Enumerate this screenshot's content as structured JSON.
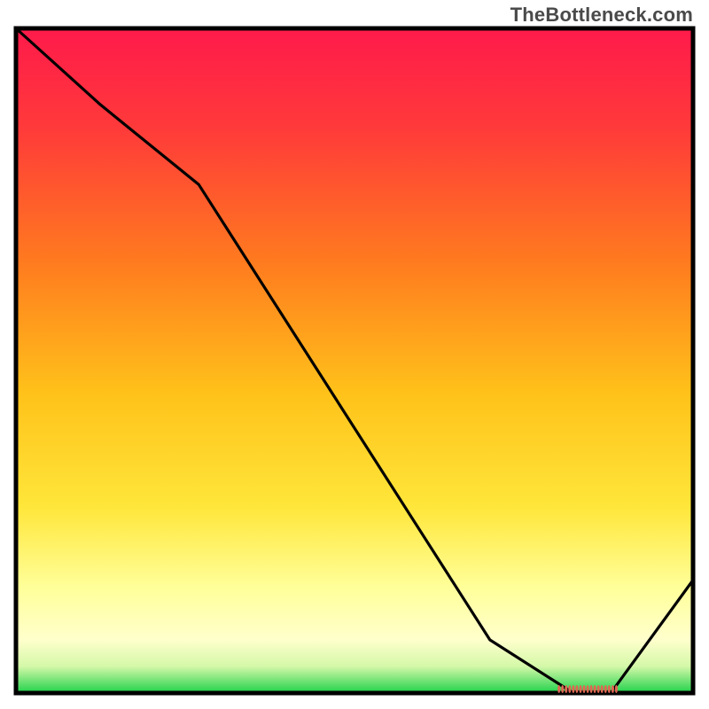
{
  "watermark": "TheBottleneck.com",
  "chart_data": {
    "type": "line",
    "title": "",
    "xlabel": "",
    "ylabel": "",
    "xlim": [
      0,
      100
    ],
    "ylim": [
      0,
      100
    ],
    "axes_visible": false,
    "legend": false,
    "background_gradient": {
      "stops": [
        {
          "offset": 0.0,
          "color": "#ff1a4b"
        },
        {
          "offset": 0.15,
          "color": "#ff3a3a"
        },
        {
          "offset": 0.35,
          "color": "#ff7a1f"
        },
        {
          "offset": 0.55,
          "color": "#ffc21a"
        },
        {
          "offset": 0.72,
          "color": "#ffe63a"
        },
        {
          "offset": 0.84,
          "color": "#ffff99"
        },
        {
          "offset": 0.92,
          "color": "#ffffcc"
        },
        {
          "offset": 0.96,
          "color": "#d4f8a8"
        },
        {
          "offset": 1.0,
          "color": "#1fd14a"
        }
      ]
    },
    "series": [
      {
        "name": "bottleneck-curve",
        "color": "#000000",
        "x": [
          0.0,
          12.5,
          27.0,
          70.0,
          82.0,
          88.0,
          100.0
        ],
        "y": [
          100.0,
          88.5,
          76.5,
          8.0,
          0.2,
          0.2,
          17.0
        ]
      }
    ],
    "markers": [
      {
        "name": "optimal-band",
        "type": "bar-strip",
        "color": "#e06653",
        "x_start": 80.0,
        "x_end": 89.0,
        "y": 0.6,
        "height": 1.2
      }
    ]
  }
}
